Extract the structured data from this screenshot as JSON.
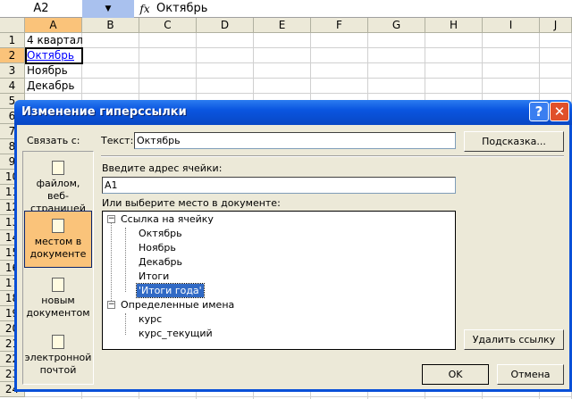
{
  "formula_bar": {
    "name_box": "A2",
    "fx": "fx",
    "formula": "Октябрь"
  },
  "columns": [
    "A",
    "B",
    "C",
    "D",
    "E",
    "F",
    "G",
    "H",
    "I",
    "J"
  ],
  "rows": [
    "1",
    "2",
    "3",
    "4",
    "5",
    "6",
    "7",
    "8",
    "9",
    "10",
    "11",
    "12",
    "13",
    "14",
    "15",
    "16",
    "17",
    "18",
    "19",
    "20",
    "21",
    "22",
    "23",
    "24"
  ],
  "cells": {
    "A1": "4 квартал",
    "A2": "Октябрь",
    "A3": "Ноябрь",
    "A4": "Декабрь"
  },
  "dialog": {
    "title": "Изменение гиперссылки",
    "help": "?",
    "close": "✕",
    "link_to_label": "Связать с:",
    "link_options": [
      {
        "label": "файлом, веб-страницей",
        "icon": "web-page-icon"
      },
      {
        "label": "местом в документе",
        "icon": "place-in-document-icon",
        "selected": true
      },
      {
        "label": "новым документом",
        "icon": "new-document-icon"
      },
      {
        "label": "электронной почтой",
        "icon": "email-icon"
      }
    ],
    "text_label": "Текст:",
    "text_value": "Октябрь",
    "tooltip_button": "Подсказка...",
    "cell_ref_label": "Введите адрес ячейки:",
    "cell_ref_value": "A1",
    "place_label": "Или выберите место в документе:",
    "tree": {
      "group1": "Ссылка на ячейку",
      "group1_items": [
        "Октябрь",
        "Ноябрь",
        "Декабрь",
        "Итоги",
        "'Итоги года'"
      ],
      "group2": "Определенные имена",
      "group2_items": [
        "курс",
        "курс_текущий"
      ],
      "selected": "'Итоги года'"
    },
    "remove_link": "Удалить ссылку",
    "ok": "OK",
    "cancel": "Отмена"
  },
  "colors": {
    "title_bar": "#0a55e0",
    "selection": "#fac37a",
    "hyperlink": "#0000ff",
    "tree_selection": "#316ac5"
  }
}
